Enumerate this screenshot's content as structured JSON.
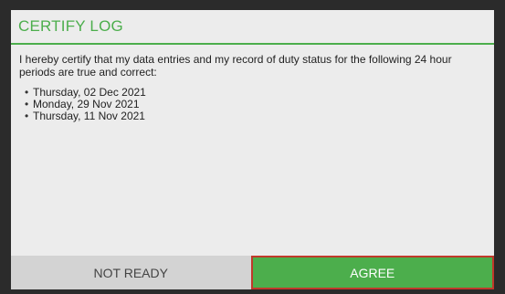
{
  "dialog": {
    "title": "CERTIFY LOG",
    "statement": "I hereby certify that my data entries and my record of duty status for the following 24 hour periods are true and correct:",
    "dates": [
      "Thursday, 02 Dec 2021",
      "Monday, 29 Nov 2021",
      "Thursday, 11 Nov 2021"
    ],
    "buttons": {
      "not_ready": "NOT READY",
      "agree": "AGREE"
    }
  },
  "colors": {
    "accent": "#4cae4c",
    "focus_border": "#c0392b",
    "secondary_button": "#d3d3d3",
    "dialog_background": "#ececec",
    "backdrop": "#2b2b2b"
  }
}
